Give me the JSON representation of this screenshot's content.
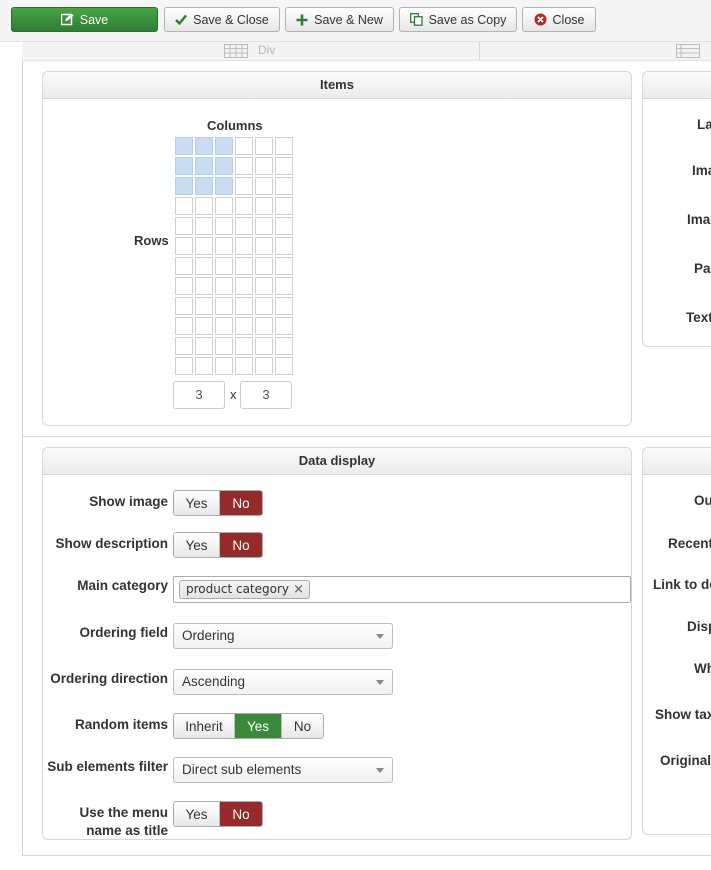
{
  "toolbar": {
    "save": "Save",
    "save_close": "Save & Close",
    "save_new": "Save & New",
    "save_copy": "Save as Copy",
    "close": "Close"
  },
  "top_strip": {
    "label": "Div"
  },
  "items_panel": {
    "title": "Items",
    "columns_label": "Columns",
    "rows_label": "Rows",
    "grid": {
      "total_rows": 12,
      "total_cols": 6,
      "selected_rows": 3,
      "selected_cols": 3
    },
    "rows_value": "3",
    "times": "x",
    "cols_value": "3"
  },
  "right_panel_1": {
    "labels": [
      "La",
      "Ima",
      "Ima",
      "Pa",
      "Text"
    ]
  },
  "data_panel": {
    "title": "Data display",
    "show_image": {
      "label": "Show image",
      "yes": "Yes",
      "no": "No"
    },
    "show_description": {
      "label": "Show description",
      "yes": "Yes",
      "no": "No"
    },
    "main_category": {
      "label": "Main category",
      "tag": "product category",
      "remove": "×"
    },
    "ordering_field": {
      "label": "Ordering field",
      "value": "Ordering"
    },
    "ordering_direction": {
      "label": "Ordering direction",
      "value": "Ascending"
    },
    "random_items": {
      "label": "Random items",
      "inherit": "Inherit",
      "yes": "Yes",
      "no": "No"
    },
    "sub_elements_filter": {
      "label": "Sub elements filter",
      "value": "Direct sub elements"
    },
    "use_menu_name": {
      "label_line1": "Use the menu",
      "label_line2": "name as title",
      "yes": "Yes",
      "no": "No"
    }
  },
  "right_panel_2": {
    "labels": [
      "Ou",
      "Recent",
      "Link to de",
      "Disp",
      "Wh",
      "Show tax",
      "Original"
    ]
  },
  "colors": {
    "save_green": "#3a8f3a",
    "no_red": "#952a2a",
    "yes_green": "#3b8a3b",
    "selected_cell": "#c9ddf3"
  }
}
